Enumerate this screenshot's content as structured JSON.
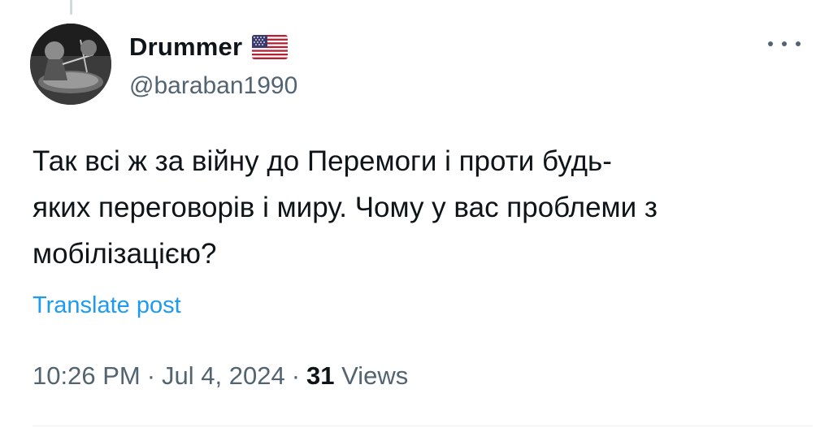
{
  "author": {
    "display_name": "Drummer",
    "flag_icon": "us-flag-icon",
    "handle": "@baraban1990"
  },
  "tweet": {
    "text_lines": [
      "Так всі ж за війну до Перемоги і проти будь-",
      "яких переговорів і миру. Чому у вас проблеми з",
      "мобілізацією?"
    ],
    "translate_label": "Translate post"
  },
  "meta": {
    "time": "10:26 PM",
    "separator": "·",
    "date": "Jul 4, 2024",
    "views_count": "31",
    "views_label": "Views"
  },
  "icons": {
    "more": "more-horizontal-icon"
  },
  "colors": {
    "text": "#0f1419",
    "secondary": "#536471",
    "link": "#1d9bf0"
  }
}
